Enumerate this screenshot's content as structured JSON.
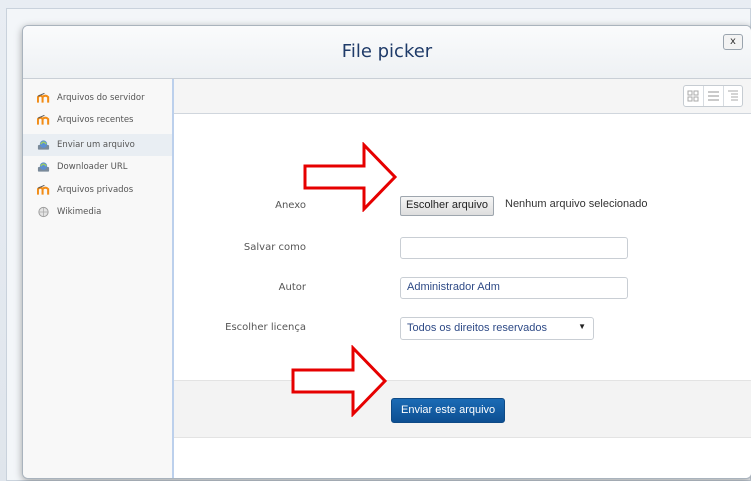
{
  "dialog": {
    "title": "File picker",
    "close_label": "x"
  },
  "sidebar": {
    "items": [
      {
        "label": "Arquivos do servidor",
        "icon": "moodle-icon"
      },
      {
        "label": "Arquivos recentes",
        "icon": "moodle-icon"
      },
      {
        "label": "Enviar um arquivo",
        "icon": "upload-icon",
        "active": true
      },
      {
        "label": "Downloader URL",
        "icon": "upload-icon"
      },
      {
        "label": "Arquivos privados",
        "icon": "moodle-icon"
      },
      {
        "label": "Wikimedia",
        "icon": "globe-icon"
      }
    ]
  },
  "toolbar": {
    "views": [
      "icons-view-icon",
      "list-view-icon",
      "tree-view-icon"
    ]
  },
  "form": {
    "attachment_label": "Anexo",
    "choose_file_label": "Escolher arquivo",
    "no_file_text": "Nenhum arquivo selecionado",
    "save_as_label": "Salvar como",
    "save_as_value": "",
    "author_label": "Autor",
    "author_value": "Administrador Adm",
    "license_label": "Escolher licença",
    "license_value": "Todos os direitos reservados",
    "submit_label": "Enviar este arquivo"
  },
  "colors": {
    "annotation_arrow": "#e60000",
    "submit_button": "#0d4f92",
    "title_text": "#1f3b69"
  }
}
